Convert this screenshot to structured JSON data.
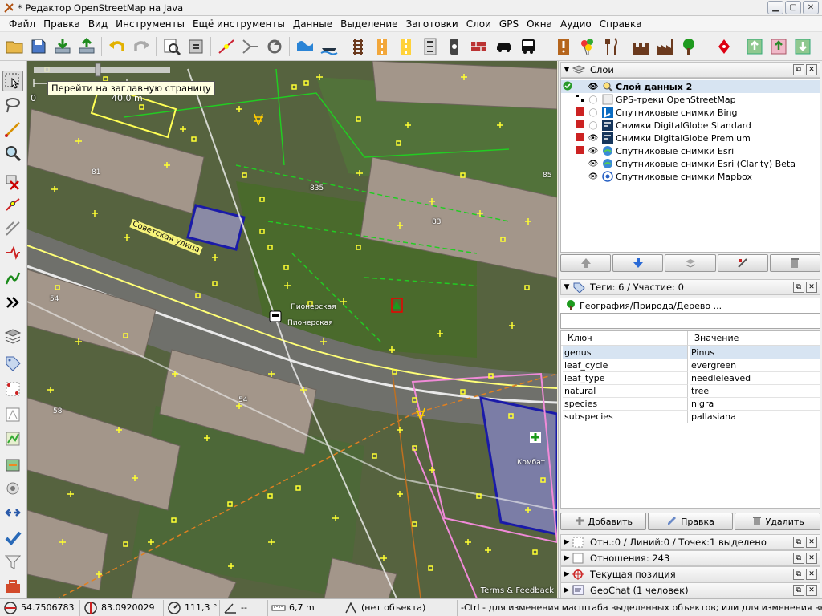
{
  "window": {
    "title": "* Редактор OpenStreetMap на Java",
    "min_label": "▁",
    "max_label": "▢",
    "close_label": "✕"
  },
  "menu": [
    "Файл",
    "Правка",
    "Вид",
    "Инструменты",
    "Ещё инструменты",
    "Данные",
    "Выделение",
    "Заготовки",
    "Слои",
    "GPS",
    "Окна",
    "Аудио",
    "Справка"
  ],
  "map": {
    "scale_start": "0",
    "scale_end": "40.0 m",
    "tooltip": "Перейти на заглавную страницу",
    "terms": "Terms & Feedback",
    "street_name": "Советская улица",
    "stop_label_1": "Пионерская",
    "stop_label_2": "Пионерская",
    "house_numbers": [
      "81",
      "835",
      "83",
      "85",
      "54",
      "58",
      "54"
    ],
    "shop_label": "Комбат"
  },
  "layers_panel": {
    "title": "Слои",
    "layers": [
      {
        "name": "Слой данных 2",
        "active": true,
        "visible": true
      },
      {
        "name": "GPS-треки OpenStreetMap",
        "active": false,
        "visible": false
      },
      {
        "name": "Спутниковые снимки Bing",
        "active": false,
        "visible": false
      },
      {
        "name": "Снимки DigitalGlobe Standard",
        "active": false,
        "visible": false
      },
      {
        "name": "Снимки DigitalGlobe Premium",
        "active": false,
        "visible": true
      },
      {
        "name": "Спутниковые снимки Esri",
        "active": false,
        "visible": true
      },
      {
        "name": "Спутниковые снимки Esri (Clarity) Beta",
        "active": false,
        "visible": true
      },
      {
        "name": "Спутниковые снимки Mapbox",
        "active": false,
        "visible": true
      }
    ]
  },
  "tags_panel": {
    "title": "Теги: 6 / Участие: 0",
    "preset": "География/Природа/Дерево ...",
    "col_key": "Ключ",
    "col_value": "Значение",
    "rows": [
      {
        "key": "genus",
        "value": "Pinus"
      },
      {
        "key": "leaf_cycle",
        "value": "evergreen"
      },
      {
        "key": "leaf_type",
        "value": "needleleaved"
      },
      {
        "key": "natural",
        "value": "tree"
      },
      {
        "key": "species",
        "value": "nigra"
      },
      {
        "key": "subspecies",
        "value": "pallasiana"
      }
    ],
    "add_label": "Добавить",
    "edit_label": "Правка",
    "delete_label": "Удалить"
  },
  "collapsed_panels": [
    {
      "title": "Отн.:0 / Линий:0 / Точек:1 выделено"
    },
    {
      "title": "Отношения: 243"
    },
    {
      "title": "Текущая позиция"
    },
    {
      "title": "GeoChat (1 человек)"
    }
  ],
  "status": {
    "lat": "54.7506783",
    "lon": "83.0920029",
    "heading": "111,3 °",
    "angle": "--",
    "distance": "6,7 m",
    "object": "(нет объекта)",
    "help": "-Ctrl - для изменения масштаба выделенных объектов; или для изменения выделения"
  },
  "colors": {
    "accent": "#d7e4f2",
    "node_yellow": "#ffff33",
    "way_green": "#22cc22",
    "building_blue": "#1a1aa8"
  }
}
